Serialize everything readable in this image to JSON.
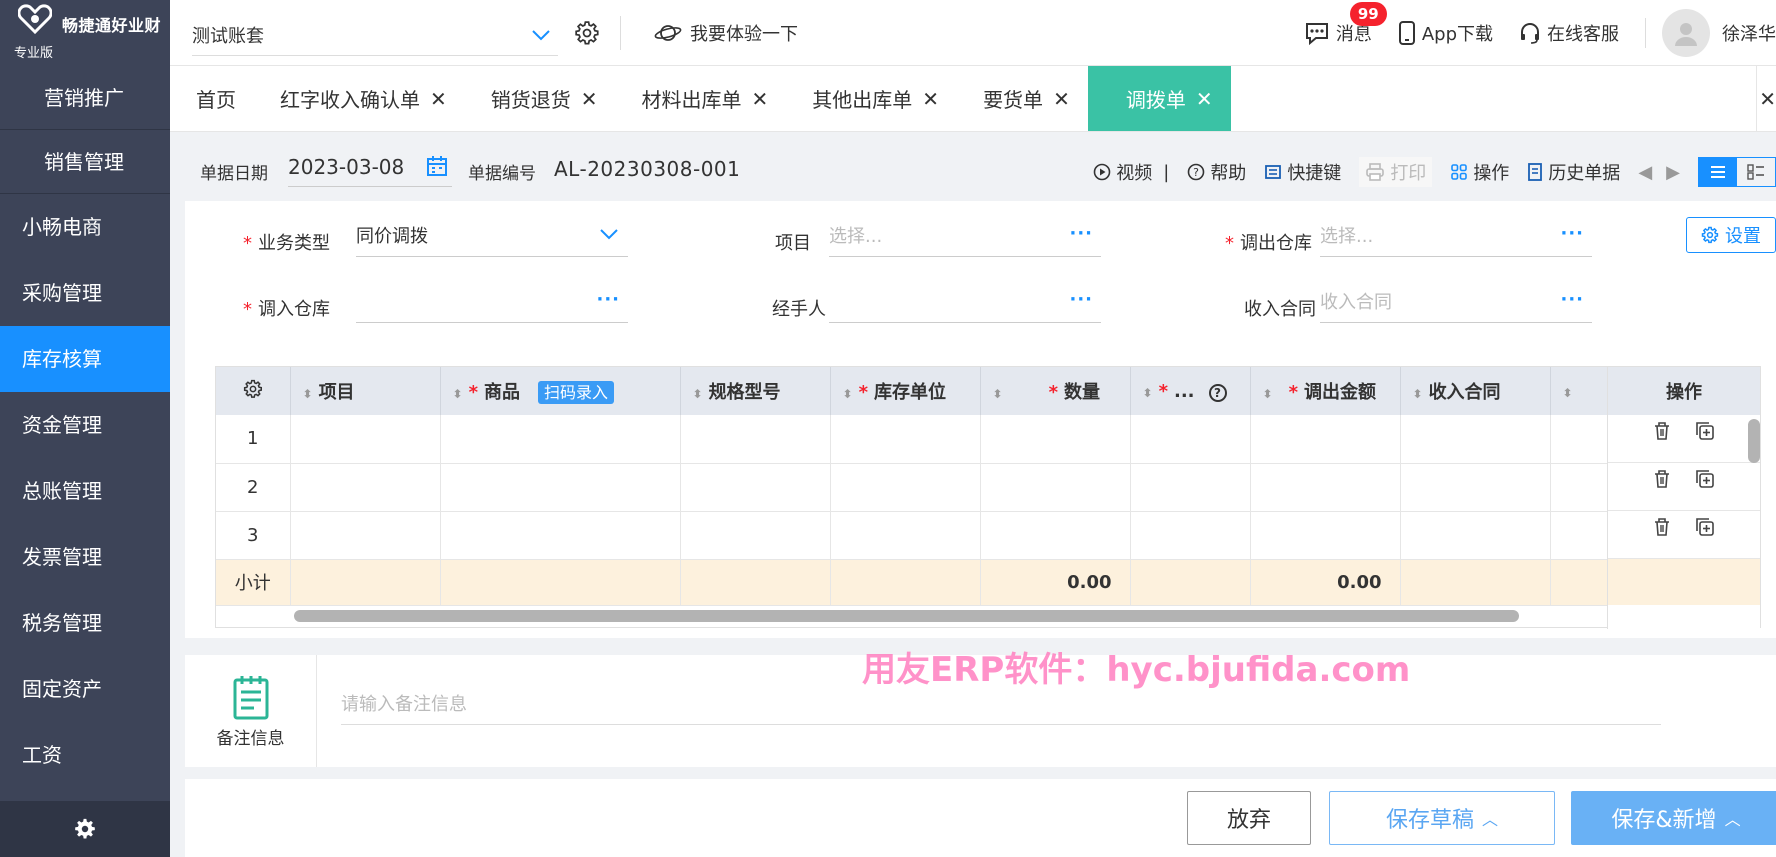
{
  "brand": {
    "name": "畅捷通好业财",
    "edition": "专业版"
  },
  "sidebar": {
    "submenu": [
      {
        "label": "营销推广"
      },
      {
        "label": "销售管理"
      }
    ],
    "items": [
      {
        "label": "小畅电商"
      },
      {
        "label": "采购管理"
      },
      {
        "label": "库存核算",
        "active": true
      },
      {
        "label": "资金管理"
      },
      {
        "label": "总账管理"
      },
      {
        "label": "发票管理"
      },
      {
        "label": "税务管理"
      },
      {
        "label": "固定资产"
      },
      {
        "label": "工资"
      }
    ],
    "footer_icon": "gear-icon"
  },
  "topbar": {
    "account": "测试账套",
    "experience": "我要体验一下",
    "messages": {
      "label": "消息",
      "badge": "99 +"
    },
    "app_download": "App下载",
    "service": "在线客服",
    "username": "徐泽华"
  },
  "tabs": [
    {
      "label": "首页",
      "closable": false
    },
    {
      "label": "红字收入确认单",
      "closable": true
    },
    {
      "label": "销货退货",
      "closable": true
    },
    {
      "label": "材料出库单",
      "closable": true
    },
    {
      "label": "其他出库单",
      "closable": true
    },
    {
      "label": "要货单",
      "closable": true
    },
    {
      "label": "调拨单",
      "closable": true,
      "active": true
    }
  ],
  "doc": {
    "date_label": "单据日期",
    "date_value": "2023-03-08",
    "no_label": "单据编号",
    "no_value": "AL-20230308-001",
    "actions": {
      "video": "视频",
      "help": "帮助",
      "shortcut": "快捷键",
      "print": "打印",
      "operate": "操作",
      "history": "历史单据"
    }
  },
  "form": {
    "biz_type": {
      "label": "业务类型",
      "value": "同价调拨"
    },
    "project": {
      "label": "项目",
      "placeholder": "选择..."
    },
    "out_wh": {
      "label": "调出仓库",
      "placeholder": "选择..."
    },
    "in_wh": {
      "label": "调入仓库"
    },
    "handler": {
      "label": "经手人"
    },
    "contract": {
      "label": "收入合同",
      "placeholder": "收入合同"
    },
    "settings": "设置"
  },
  "table": {
    "headers": {
      "project": "项目",
      "goods": "商品",
      "scan": "扫码录入",
      "spec": "规格型号",
      "unit": "库存单位",
      "qty": "数量",
      "trunc": "...",
      "amount": "调出金额",
      "contract": "收入合同",
      "op": "操作"
    },
    "rows": [
      "1",
      "2",
      "3"
    ],
    "subtotal": {
      "label": "小计",
      "qty": "0.00",
      "amount": "0.00"
    }
  },
  "remarks": {
    "label": "备注信息",
    "placeholder": "请输入备注信息"
  },
  "watermark": "用友ERP软件：hyc.bjufida.com",
  "footer": {
    "abandon": "放弃",
    "draft": "保存草稿",
    "save_new": "保存&新增"
  }
}
